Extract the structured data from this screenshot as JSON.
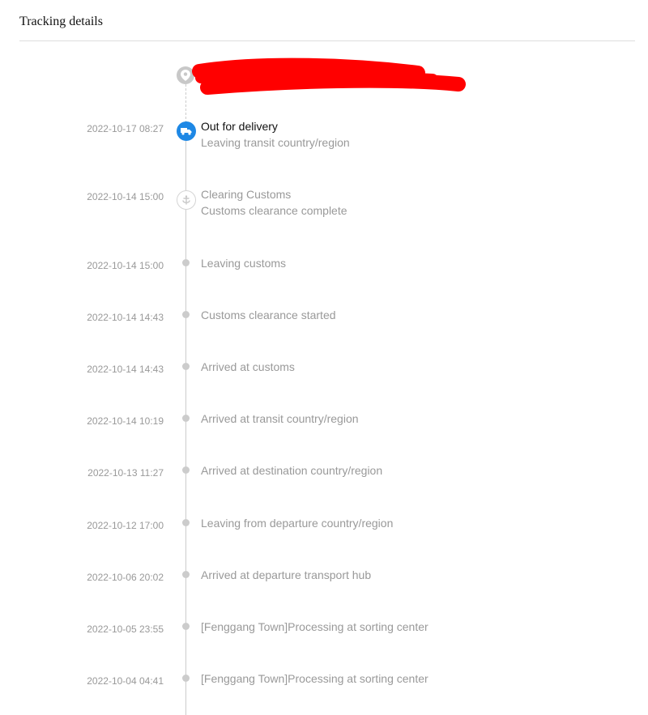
{
  "page": {
    "title": "Tracking details"
  },
  "colors": {
    "active_node": "#1e88e5",
    "rail": "#cccccc",
    "redaction": "#ff0000",
    "muted_text": "#999999",
    "active_text": "#111111"
  },
  "destination": {
    "icon": "location-pin-icon",
    "address_redacted": true
  },
  "events": [
    {
      "time": "2022-10-17 08:27",
      "title": "Out for delivery",
      "detail": "Leaving transit country/region",
      "icon": "truck-icon",
      "active": true
    },
    {
      "time": "2022-10-14 15:00",
      "title": "Clearing Customs",
      "detail": "Customs clearance complete",
      "icon": "customs-icon",
      "active": false
    },
    {
      "time": "2022-10-14 15:00",
      "title": "Leaving customs"
    },
    {
      "time": "2022-10-14 14:43",
      "title": "Customs clearance started"
    },
    {
      "time": "2022-10-14 14:43",
      "title": "Arrived at customs"
    },
    {
      "time": "2022-10-14 10:19",
      "title": "Arrived at transit country/region"
    },
    {
      "time": "2022-10-13 11:27",
      "title": "Arrived at destination country/region"
    },
    {
      "time": "2022-10-12 17:00",
      "title": "Leaving from departure country/region"
    },
    {
      "time": "2022-10-06 20:02",
      "title": "Arrived at departure transport hub"
    },
    {
      "time": "2022-10-05 23:55",
      "title": "[Fenggang Town]Processing at sorting center"
    },
    {
      "time": "2022-10-04 04:41",
      "title": "[Fenggang Town]Processing at sorting center"
    }
  ]
}
